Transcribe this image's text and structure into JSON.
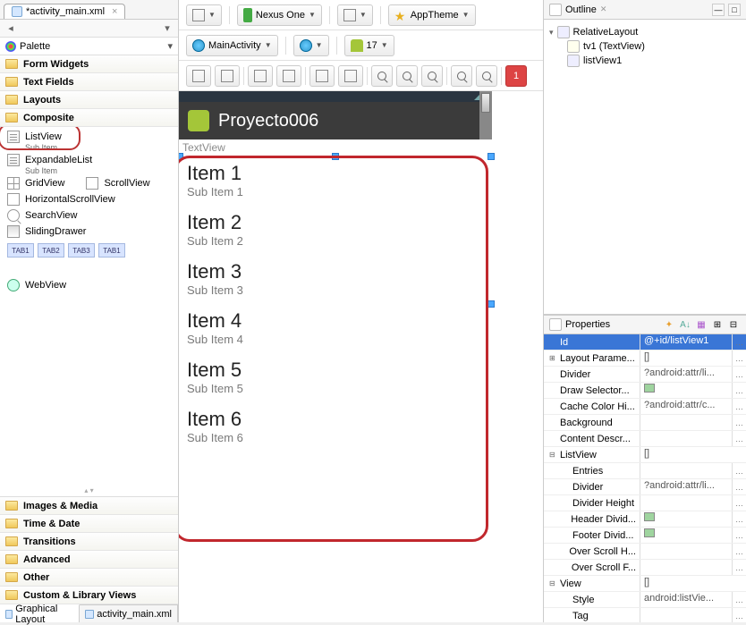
{
  "tab_title": "*activity_main.xml",
  "palette": {
    "title": "Palette",
    "folders_top": [
      "Form Widgets",
      "Text Fields",
      "Layouts",
      "Composite"
    ],
    "composite_items": [
      {
        "label": "ListView",
        "sub": "Sub Item"
      },
      {
        "label": "ExpandableList",
        "sub": "Sub Item"
      },
      {
        "label": "GridView"
      },
      {
        "label": "ScrollView"
      },
      {
        "label": "HorizontalScrollView"
      },
      {
        "label": "SearchView"
      },
      {
        "label": "SlidingDrawer"
      }
    ],
    "tabs": [
      "TAB1",
      "TAB2",
      "TAB3",
      "TAB1"
    ],
    "webview": "WebView",
    "folders_bottom": [
      "Images & Media",
      "Time & Date",
      "Transitions",
      "Advanced",
      "Other",
      "Custom & Library Views"
    ]
  },
  "bottom_tabs": {
    "graphical": "Graphical Layout",
    "source": "activity_main.xml"
  },
  "toolbar": {
    "device": "Nexus One",
    "theme": "AppTheme",
    "activity": "MainActivity",
    "api": "17"
  },
  "device_preview": {
    "app_title": "Proyecto006",
    "text_view": "TextView",
    "items": [
      {
        "title": "Item 1",
        "sub": "Sub Item 1"
      },
      {
        "title": "Item 2",
        "sub": "Sub Item 2"
      },
      {
        "title": "Item 3",
        "sub": "Sub Item 3"
      },
      {
        "title": "Item 4",
        "sub": "Sub Item 4"
      },
      {
        "title": "Item 5",
        "sub": "Sub Item 5"
      },
      {
        "title": "Item 6",
        "sub": "Sub Item 6"
      }
    ]
  },
  "outline": {
    "title": "Outline",
    "root": "RelativeLayout",
    "children": [
      {
        "label": "tv1 (TextView)"
      },
      {
        "label": "listView1"
      }
    ]
  },
  "properties": {
    "title": "Properties",
    "rows": [
      {
        "label": "Id",
        "value": "@+id/listView1",
        "selected": true,
        "btn": true
      },
      {
        "label": "Layout Parame...",
        "value": "[]",
        "expand": "+",
        "btn": true
      },
      {
        "label": "Divider",
        "value": "?android:attr/li...",
        "btn": true
      },
      {
        "label": "Draw Selector...",
        "value": "",
        "swatch": true,
        "btn": true
      },
      {
        "label": "Cache Color Hi...",
        "value": "?android:attr/c...",
        "btn": true
      },
      {
        "label": "Background",
        "value": "",
        "btn": true
      },
      {
        "label": "Content Descr...",
        "value": "",
        "btn": true
      },
      {
        "label": "ListView",
        "value": "[]",
        "expand": "-",
        "section": true
      },
      {
        "label": "Entries",
        "value": "",
        "indent": 1,
        "btn": true
      },
      {
        "label": "Divider",
        "value": "?android:attr/li...",
        "indent": 1,
        "btn": true
      },
      {
        "label": "Divider Height",
        "value": "",
        "indent": 1,
        "btn": true
      },
      {
        "label": "Header Divid...",
        "value": "",
        "indent": 1,
        "swatch": true,
        "btn": true
      },
      {
        "label": "Footer Divid...",
        "value": "",
        "indent": 1,
        "swatch": true,
        "btn": true
      },
      {
        "label": "Over Scroll H...",
        "value": "",
        "indent": 1,
        "btn": true
      },
      {
        "label": "Over Scroll F...",
        "value": "",
        "indent": 1,
        "btn": true
      },
      {
        "label": "View",
        "value": "[]",
        "expand": "-",
        "section": true
      },
      {
        "label": "Style",
        "value": "android:listVie...",
        "indent": 1,
        "btn": true
      },
      {
        "label": "Tag",
        "value": "",
        "indent": 1,
        "btn": true
      }
    ]
  }
}
